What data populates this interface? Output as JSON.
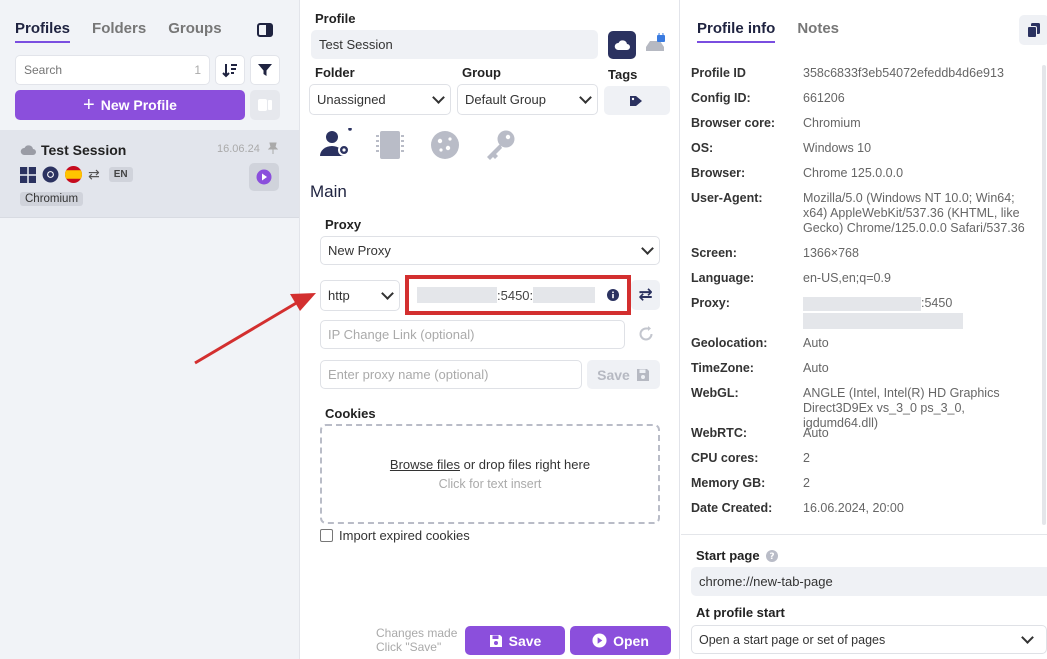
{
  "sidebar": {
    "tabs": [
      {
        "label": "Profiles",
        "active": true
      },
      {
        "label": "Folders",
        "active": false
      },
      {
        "label": "Groups",
        "active": false
      }
    ],
    "search": {
      "placeholder": "Search",
      "count": "1"
    },
    "new_profile_label": "New Profile",
    "profile": {
      "name": "Test Session",
      "date": "16.06.24",
      "lang": "EN",
      "core": "Chromium"
    }
  },
  "main": {
    "profile_label": "Profile",
    "profile_name": "Test Session",
    "folder_label": "Folder",
    "folder_value": "Unassigned",
    "group_label": "Group",
    "group_value": "Default Group",
    "tags_label": "Tags",
    "section_title": "Main",
    "proxy_label": "Proxy",
    "proxy_value": "New Proxy",
    "protocol": "http",
    "proxy_port_text": ":5450:",
    "ip_change_placeholder": "IP Change Link (optional)",
    "proxy_name_placeholder": "Enter proxy name (optional)",
    "save_small_label": "Save",
    "cookies_label": "Cookies",
    "browse_files": "Browse files",
    "drop_text": "or drop files right here",
    "click_text": "Click for text insert",
    "import_expired": "Import expired cookies",
    "changes_line1": "Changes made",
    "changes_line2": "Click \"Save\"",
    "save_label": "Save",
    "open_label": "Open"
  },
  "info": {
    "tabs": [
      {
        "label": "Profile info",
        "active": true
      },
      {
        "label": "Notes",
        "active": false
      }
    ],
    "rows": [
      {
        "key": "Profile ID",
        "value": "358c6833f3eb54072efeddb4d6e913"
      },
      {
        "key": "Config ID:",
        "value": "661206"
      },
      {
        "key": "Browser core:",
        "value": "Chromium"
      },
      {
        "key": "OS:",
        "value": "Windows 10"
      },
      {
        "key": "Browser:",
        "value": "Chrome 125.0.0.0"
      },
      {
        "key": "User-Agent:",
        "value": "Mozilla/5.0 (Windows NT 10.0; Win64; x64) AppleWebKit/537.36 (KHTML, like Gecko) Chrome/125.0.0.0 Safari/537.36"
      },
      {
        "key": "Screen:",
        "value": "1366×768"
      },
      {
        "key": "Language:",
        "value": "en-US,en;q=0.9"
      },
      {
        "key": "Proxy:",
        "value": ":5450"
      },
      {
        "key": "Geolocation:",
        "value": "Auto"
      },
      {
        "key": "TimeZone:",
        "value": "Auto"
      },
      {
        "key": "WebGL:",
        "value": "ANGLE (Intel, Intel(R) HD Graphics Direct3D9Ex vs_3_0 ps_3_0, igdumd64.dll)"
      },
      {
        "key": "WebRTC:",
        "value": "Auto"
      },
      {
        "key": "CPU cores:",
        "value": "2"
      },
      {
        "key": "Memory GB:",
        "value": "2"
      },
      {
        "key": "Date Created:",
        "value": "16.06.2024, 20:00"
      }
    ],
    "start_page_label": "Start page",
    "start_page_value": "chrome://new-tab-page",
    "at_profile_start_label": "At profile start",
    "at_profile_start_value": "Open a start page or set of pages"
  },
  "colors": {
    "accent": "#8b4fdc",
    "navy": "#2b3260",
    "highlight": "#d32f2f",
    "sidebar_bg": "#f1f3f7"
  }
}
